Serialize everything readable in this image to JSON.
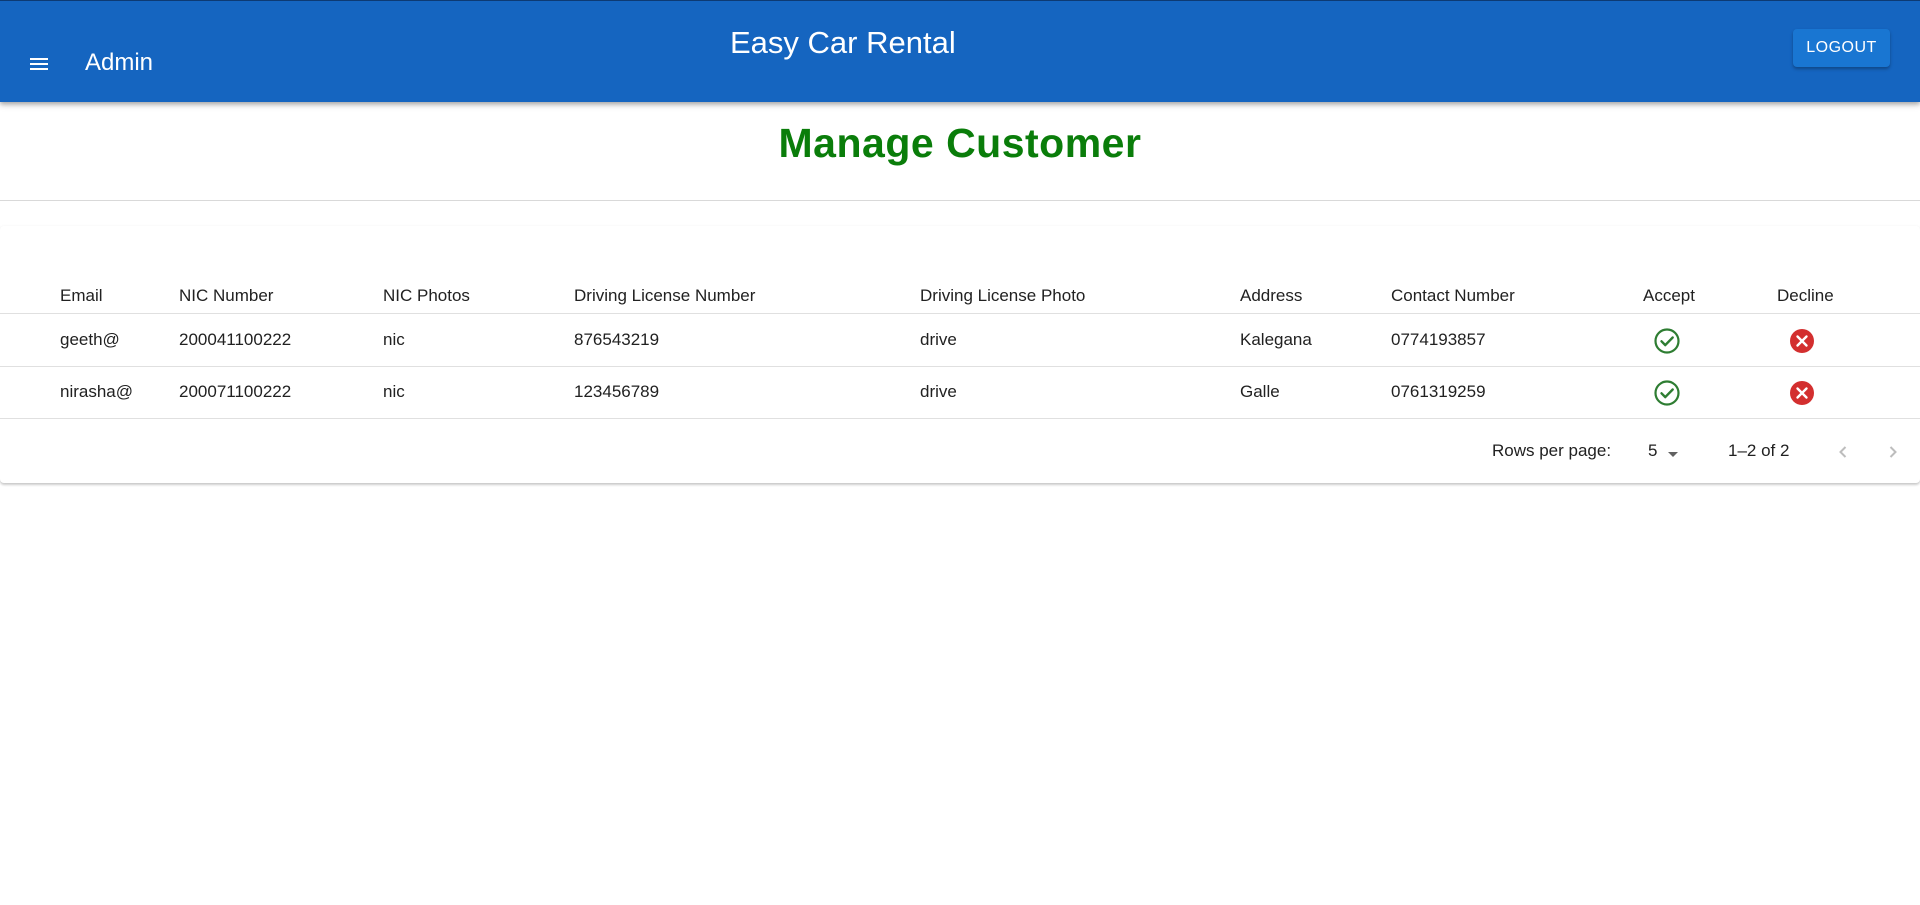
{
  "appbar": {
    "section_label": "Admin",
    "title": "Easy Car Rental",
    "logout_label": "LOGOUT",
    "color": "#1565c0"
  },
  "page": {
    "title": "Manage Customer",
    "title_color": "#0a7d0a"
  },
  "table": {
    "columns": [
      "Email",
      "NIC Number",
      "NIC Photos",
      "Driving License Number",
      "Driving License Photo",
      "Address",
      "Contact Number",
      "Accept",
      "Decline"
    ],
    "rows": [
      {
        "email": "geeth@",
        "nic_number": "200041100222",
        "nic_photos": "nic",
        "license_number": "876543219",
        "license_photo": "drive",
        "address": "Kalegana",
        "contact": "0774193857",
        "accept_icon": "check-circle-icon",
        "decline_icon": "cancel-icon"
      },
      {
        "email": "nirasha@",
        "nic_number": "200071100222",
        "nic_photos": "nic",
        "license_number": "123456789",
        "license_photo": "drive",
        "address": "Galle",
        "contact": "0761319259",
        "accept_icon": "check-circle-icon",
        "decline_icon": "cancel-icon"
      }
    ],
    "accept_color": "#2e7d32",
    "decline_color": "#d32f2f"
  },
  "pagination": {
    "rows_per_page_label": "Rows per page:",
    "rows_per_page_value": "5",
    "range_label": "1–2 of 2"
  }
}
